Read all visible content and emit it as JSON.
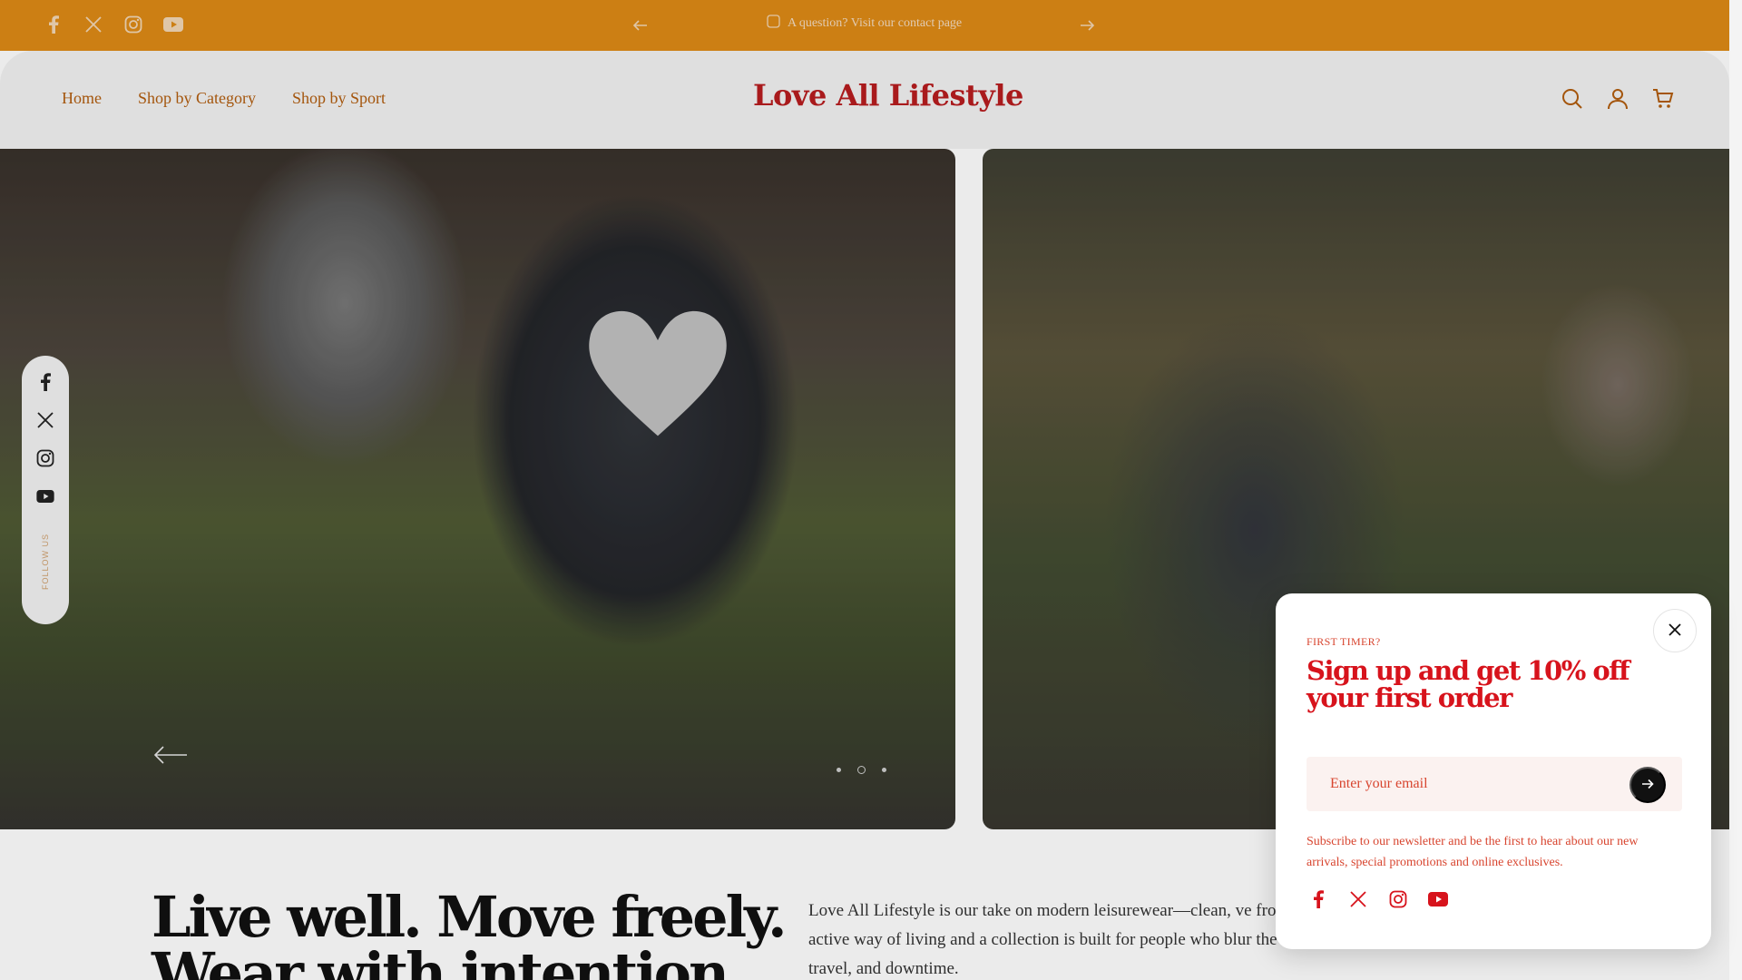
{
  "announcement": {
    "message": "A question? Visit our contact page",
    "icons": [
      "facebook-icon",
      "x-icon",
      "instagram-icon",
      "youtube-icon",
      "arrow-left-icon",
      "arrow-right-icon",
      "chat-icon"
    ],
    "background": "#de8a16"
  },
  "header": {
    "logo": "Love All Lifestyle",
    "nav": [
      "Home",
      "Shop by Category",
      "Shop by Sport"
    ],
    "icons": [
      "search-icon",
      "account-icon",
      "cart-icon"
    ],
    "accent": "#b25d0e",
    "logo_color": "#b81d1f"
  },
  "hero": {
    "slides_total": 3,
    "active_slide": 2,
    "icons": [
      "arrow-left-icon"
    ]
  },
  "floating_social": {
    "label": "FOLLOW US",
    "icons": [
      "facebook-icon",
      "x-icon",
      "instagram-icon",
      "youtube-icon"
    ]
  },
  "content": {
    "headline_line1": "Live well. Move freely.",
    "headline_line2": "Wear with intention.",
    "intro": "Love All Lifestyle is our take on modern leisurewear—clean, ve from morning to night. Inspired by an active way of living and a collection is built for people who blur the lines between work, movement, travel, and downtime."
  },
  "popup": {
    "eyebrow": "FIRST TIMER?",
    "title": "Sign up and get 10% off your first order",
    "email_placeholder": "Enter your email",
    "note": "Subscribe to our newsletter and be the first to hear about our new arrivals, special promotions and online exclusives.",
    "icons": [
      "close-icon",
      "arrow-right-icon",
      "facebook-icon",
      "x-icon",
      "instagram-icon",
      "youtube-icon"
    ],
    "accent": "#d7131c"
  }
}
